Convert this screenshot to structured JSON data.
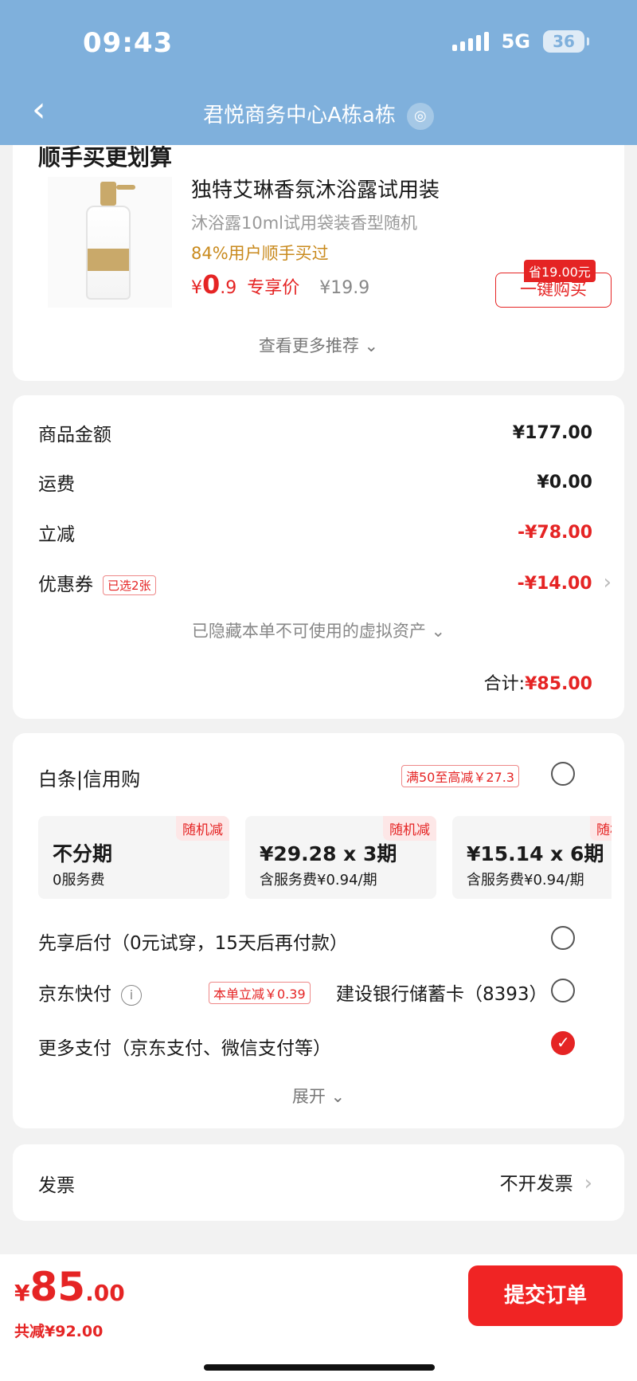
{
  "status": {
    "time": "09:43",
    "network": "5G",
    "battery": "36"
  },
  "nav": {
    "title": "君悦商务中心A栋a栋"
  },
  "recommend": {
    "title": "顺手买更划算",
    "product_name": "独特艾琳香氛沐浴露试用装",
    "product_desc": "沐浴露10ml试用袋装香型随机",
    "buyers": "84%用户顺手买过",
    "price_symbol": "¥",
    "price_int": "0",
    "price_dec": ".9",
    "price_label": "专享价",
    "orig_price": "¥19.9",
    "save_tag": "省19.00元",
    "buy_label": "一键购买",
    "more_label": "查看更多推荐 ⌄"
  },
  "summary": {
    "rows": [
      {
        "label": "商品金额",
        "value": "¥177.00"
      },
      {
        "label": "运费",
        "value": "¥0.00"
      },
      {
        "label": "立减",
        "value": "-¥78.00"
      },
      {
        "label": "优惠券",
        "value": "-¥14.00",
        "chip": "已选2张"
      }
    ],
    "hidden_assets": "已隐藏本单不可使用的虚拟资产 ⌄",
    "total_label": "合计:",
    "total_value": "¥85.00"
  },
  "payment": {
    "baitiao_label": "白条|信用购",
    "baitiao_promo": "满50至高减￥27.3",
    "plans": [
      {
        "badge": "随机减",
        "main": "不分期",
        "sub": "0服务费"
      },
      {
        "badge": "随机减",
        "main": "¥29.28 x 3期",
        "sub": "含服务费¥0.94/期"
      },
      {
        "badge": "随机减",
        "main": "¥15.14 x 6期",
        "sub": "含服务费¥0.94/期"
      }
    ],
    "pay_later": "先享后付（0元试穿，15天后再付款）",
    "jd_quick": "京东快付",
    "jd_promo": "本单立减￥0.39",
    "bank_card": "建设银行储蓄卡（8393）",
    "more_pay": "更多支付（京东支付、微信支付等）",
    "expand_label": "展开 ⌄"
  },
  "invoice": {
    "label": "发票",
    "value": "不开发票"
  },
  "bottom": {
    "currency": "¥",
    "amount_int": "85",
    "amount_dec": ".00",
    "saved": "共减¥92.00",
    "submit_label": "提交订单"
  },
  "colors": {
    "accent": "#e52424",
    "header": "#7fb0dc"
  }
}
